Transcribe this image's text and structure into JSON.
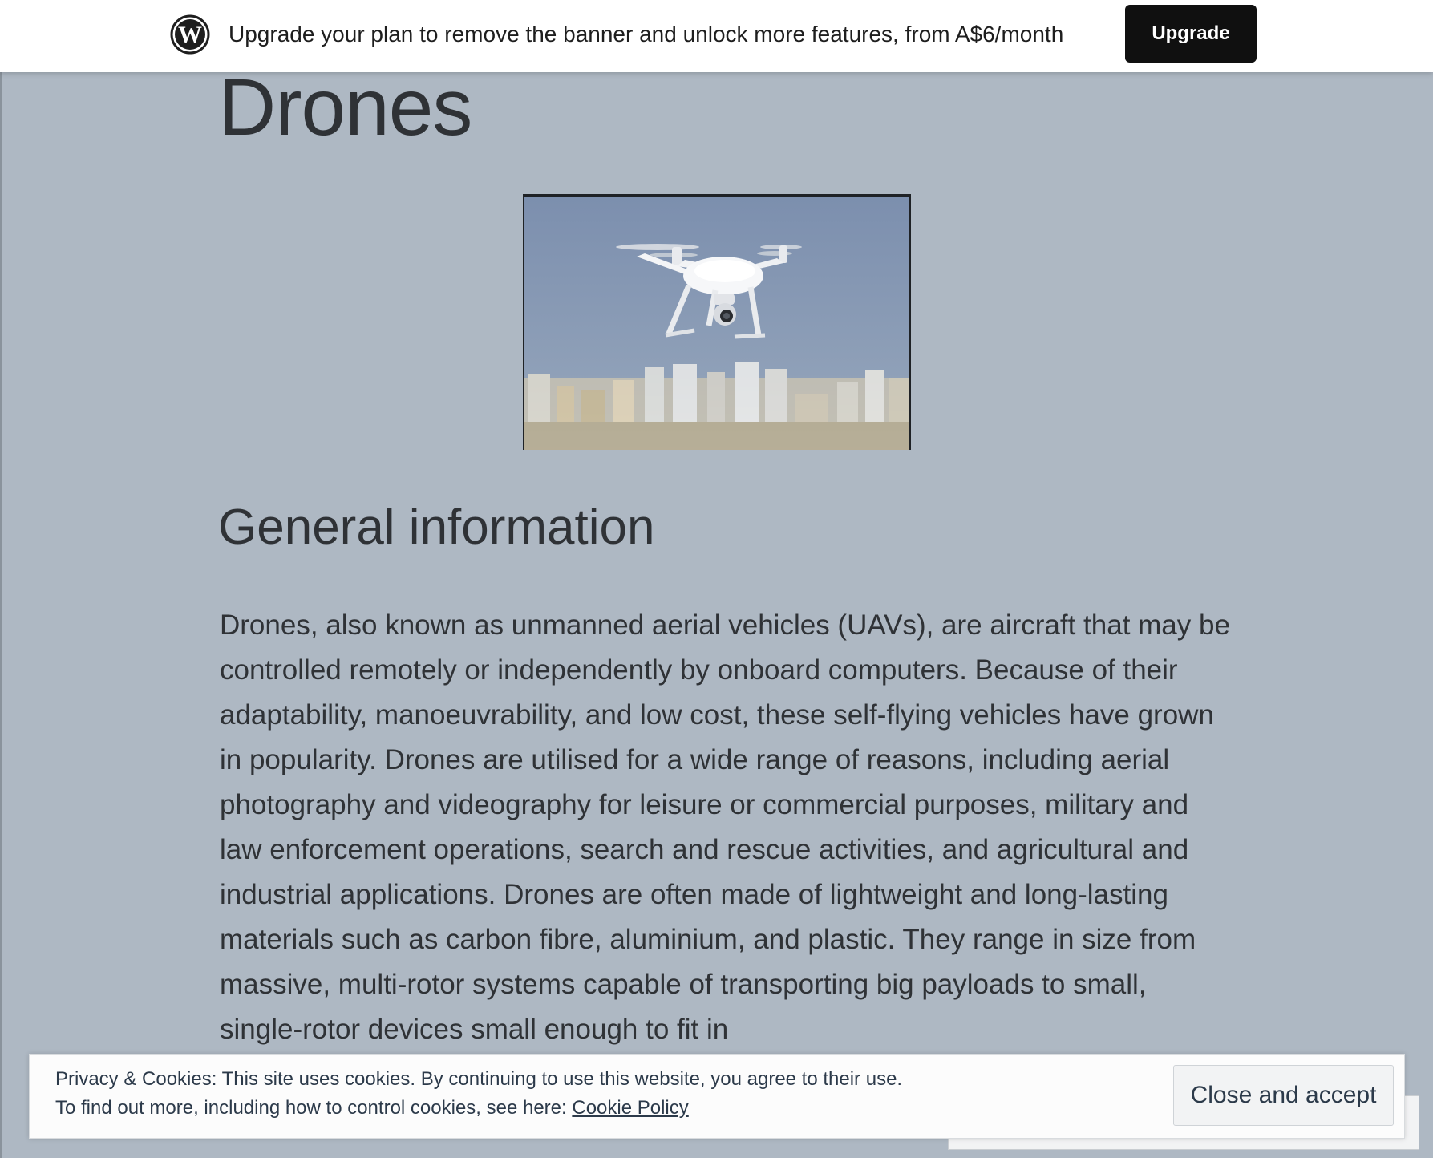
{
  "banner": {
    "logo_icon": "wordpress-logo-icon",
    "message": "Upgrade your plan to remove the banner and unlock more features, from A$6/month",
    "upgrade_label": "Upgrade"
  },
  "article": {
    "title": "Drones",
    "image_icon": "drone-photo",
    "section_heading": "General information",
    "paragraph": "Drones, also known as unmanned aerial vehicles (UAVs), are aircraft that may be controlled remotely or independently by onboard computers. Because of their adaptability, manoeuvrability, and low cost, these self-flying vehicles have grown in popularity. Drones are utilised for a wide range of reasons, including aerial photography and videography for leisure or commercial purposes, military and law enforcement operations, search and rescue activities, and agricultural and industrial applications. Drones are often made of lightweight and long-lasting materials such as carbon fibre, aluminium, and plastic. They range in size from massive, multi-rotor systems capable of transporting big payloads to small, single-rotor devices small enough to fit in"
  },
  "cookie_notice": {
    "line1": "Privacy & Cookies: This site uses cookies. By continuing to use this website, you agree to their use.",
    "line2_prefix": "To find out more, including how to control cookies, see here: ",
    "policy_link": "Cookie Policy",
    "accept_label": "Close and accept"
  },
  "colors": {
    "page_background": "#aeb8c3",
    "text": "#2f3236",
    "upgrade_button": "#101010"
  }
}
